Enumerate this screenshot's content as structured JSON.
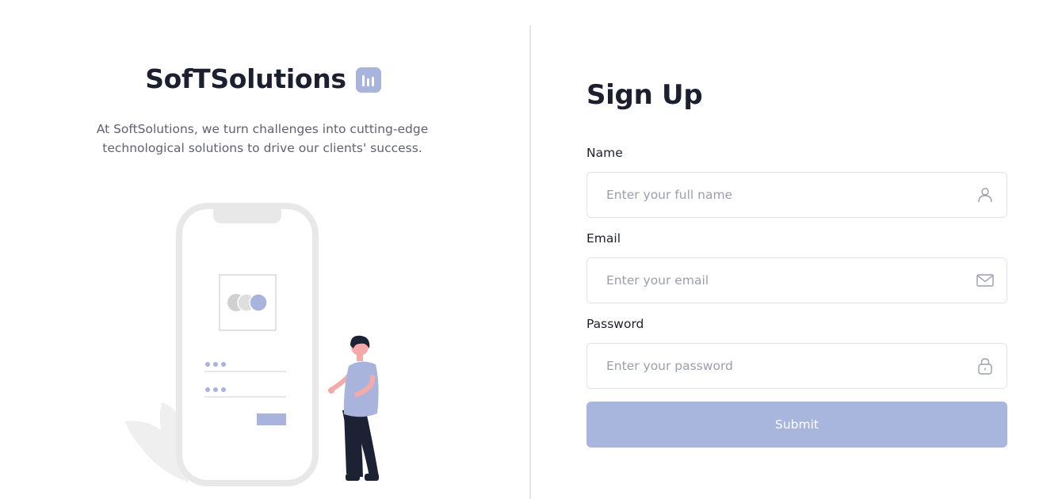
{
  "brand": {
    "name": "SofTSolutions",
    "icon": "bar-chart-icon",
    "tagline": "At SoftSolutions, we turn challenges into cutting-edge technological solutions to drive our clients' success."
  },
  "form": {
    "title": "Sign Up",
    "fields": [
      {
        "label": "Name",
        "placeholder": "Enter your full name",
        "icon": "user-icon"
      },
      {
        "label": "Email",
        "placeholder": "Enter your email",
        "icon": "mail-icon"
      },
      {
        "label": "Password",
        "placeholder": "Enter your password",
        "icon": "lock-icon"
      }
    ],
    "submit_label": "Submit"
  },
  "colors": {
    "accent": "#a8b6dd",
    "text_dark": "#1c1f2e",
    "text_muted": "#5e6272",
    "border": "#e2e4ea"
  }
}
